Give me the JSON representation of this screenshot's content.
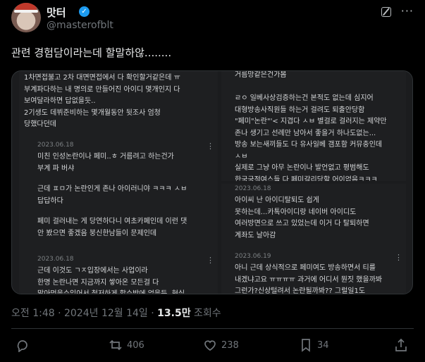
{
  "author": {
    "name": "맛터",
    "handle": "@masterofblt",
    "verified_icon": "verified-badge-icon"
  },
  "tweet": {
    "text": "관련 경험담이라는데 할말하않........"
  },
  "screenshot": {
    "left_top": "1차면접불고 2차 대면면접에서 다 확인할거같은데 ㅠ\n부계파다하는 내 명의로 만들어진 아이디 몇개인지 다\n보여달라하면 답없을듯..\n2기생도 데뷔준비하는 몇개월동안 뒷조사 엄청\n당했다던데",
    "left_date": "2023.06.18",
    "left_a": "미친 인성논란이나 페미..ㅎ 거름려고 하는건가\n부계 파 버샤",
    "left_b": "근데 ㅍㅁ가 논란인게 존나 아이러니야 ㅋㅋㅋ ㅅㅂ\n답답하다",
    "left_c": "페미 걸러내는 게 당연하다니 여초카페인데 이런 댓\n안 봤으면 좋겠음 붕신한남들이 문제인데",
    "left_date2": "2023.06.18",
    "left_d": "근데 이것도 ㄱㅈ입장에서는 사업이라\n한명 논란나면 지금까지 쌓아온 모든걸 다\n말아먹을수있어서 철저하게 할수밖에 없을듯..현실",
    "right_top": "거름망같은건가봄\n\nㄹㅇ 일베사상검증하는건 본적도 없는데 심지어\n대형방송사직원들 하는거 걸려도 퇴출안당함\n\"페미\"논란\"'< 지겹다 ㅅㅂ 별걸로 걸러지는 제약만\n존나 생기고 선례만 남아서 좋을거 하나도없는...\n방송 보는새끼들도 다 유사일베 갬포함 커뮤충인데\nㅅㅂ\n실제로 그냥 아무 논란이나 발언없고 평범해도\n한국국적여스들 다 페미갈리당할 어이없음ㅋㅋㅋ",
    "right_date": "2023.06.18",
    "right_a": "아이씨 난 아이디탈퇴도 쉽게\n못하는데...카톡아이디랑 네이버 아이디도\n여러방면으로 쓰고 있었는데 이거 다 탈퇴하면\n계좌도 날아감",
    "right_date2": "2023.06.19",
    "right_b": "아니 근데 상식적으로 페미여도 방송하면서 티를\n내겠냐고요 ㅠㅠㅠㅠ 과거에 어디서 뭔짓 했을까봐\n그런가?신상털려서 논란될까봐?? 그럴일1도"
  },
  "meta": {
    "time": "오전 1:48 · 2024년 12월 14일 · ",
    "views": "13.5만",
    "views_label": " 조회수"
  },
  "actions": {
    "retweets": "406",
    "likes": "238",
    "bookmarks": "34"
  }
}
